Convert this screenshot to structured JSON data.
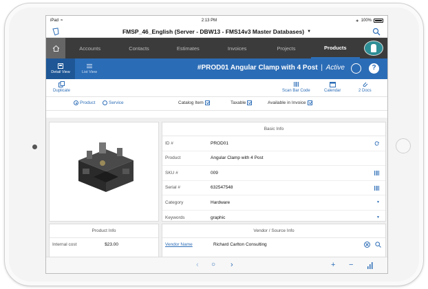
{
  "status_bar": {
    "carrier": "iPad",
    "time": "2:13 PM",
    "battery": "100%"
  },
  "title_bar": {
    "title": "FMSP_46_English (Server - DBW13 - FMS14v3 Master Databases)"
  },
  "nav": {
    "tabs": [
      {
        "label": "Accounts"
      },
      {
        "label": "Contacts"
      },
      {
        "label": "Estimates"
      },
      {
        "label": "Invoices"
      },
      {
        "label": "Projects"
      },
      {
        "label": "Products",
        "active": true
      }
    ]
  },
  "toolbar": {
    "detail_view": "Detail View",
    "list_view": "List View",
    "record_title": "#PROD01 Angular Clamp with 4 Post",
    "record_sep": "|",
    "record_state": "Active"
  },
  "actions": {
    "duplicate": "Duplicate",
    "scan_bar_code": "Scan Bar Code",
    "calendar": "Calendar",
    "docs": "2 Docs"
  },
  "options": {
    "product": "Product",
    "service": "Service",
    "catalog_item": "Catalog Item",
    "taxable": "Taxable",
    "available_in_invoice": "Available in Invoice"
  },
  "basic_info": {
    "heading": "Basic Info",
    "fields": [
      {
        "label": "ID #",
        "value": "PROD01"
      },
      {
        "label": "Product",
        "value": "Angular Clamp with 4 Post"
      },
      {
        "label": "SKU #",
        "value": "009"
      },
      {
        "label": "Serial #",
        "value": "632547548"
      },
      {
        "label": "Category",
        "value": "Hardware"
      },
      {
        "label": "Keywords",
        "value": "graphic"
      }
    ]
  },
  "product_info": {
    "heading": "Product Info",
    "internal_cost_label": "Internal cost",
    "internal_cost_value": "$23.00"
  },
  "vendor_info": {
    "heading": "Vendor / Source Info",
    "vendor_name_label": "Vendor Name",
    "vendor_name_value": "Richard Carlton Consulting"
  },
  "colors": {
    "accent": "#2b6cb6",
    "nav_bg": "#3b3b3b"
  }
}
